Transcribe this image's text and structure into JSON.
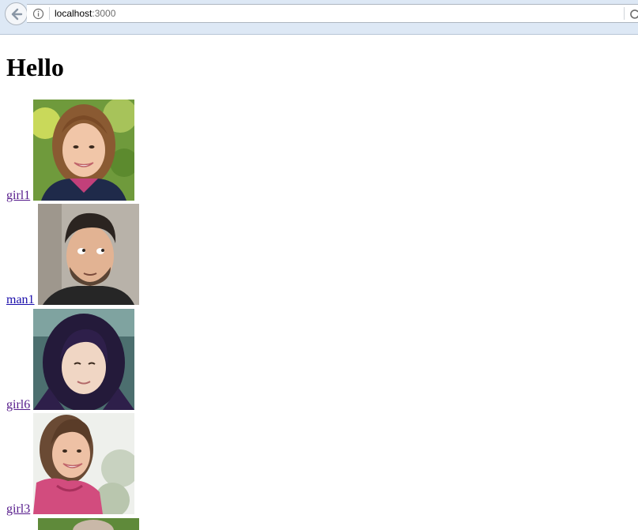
{
  "browser": {
    "url_host": "localhost",
    "url_port": ":3000"
  },
  "page": {
    "heading": "Hello",
    "people": [
      {
        "label": "girl1",
        "visited": true,
        "icon": "portrait-photo"
      },
      {
        "label": "man1",
        "visited": false,
        "icon": "portrait-photo"
      },
      {
        "label": "girl6",
        "visited": true,
        "icon": "portrait-photo"
      },
      {
        "label": "girl3",
        "visited": true,
        "icon": "portrait-photo"
      }
    ]
  }
}
